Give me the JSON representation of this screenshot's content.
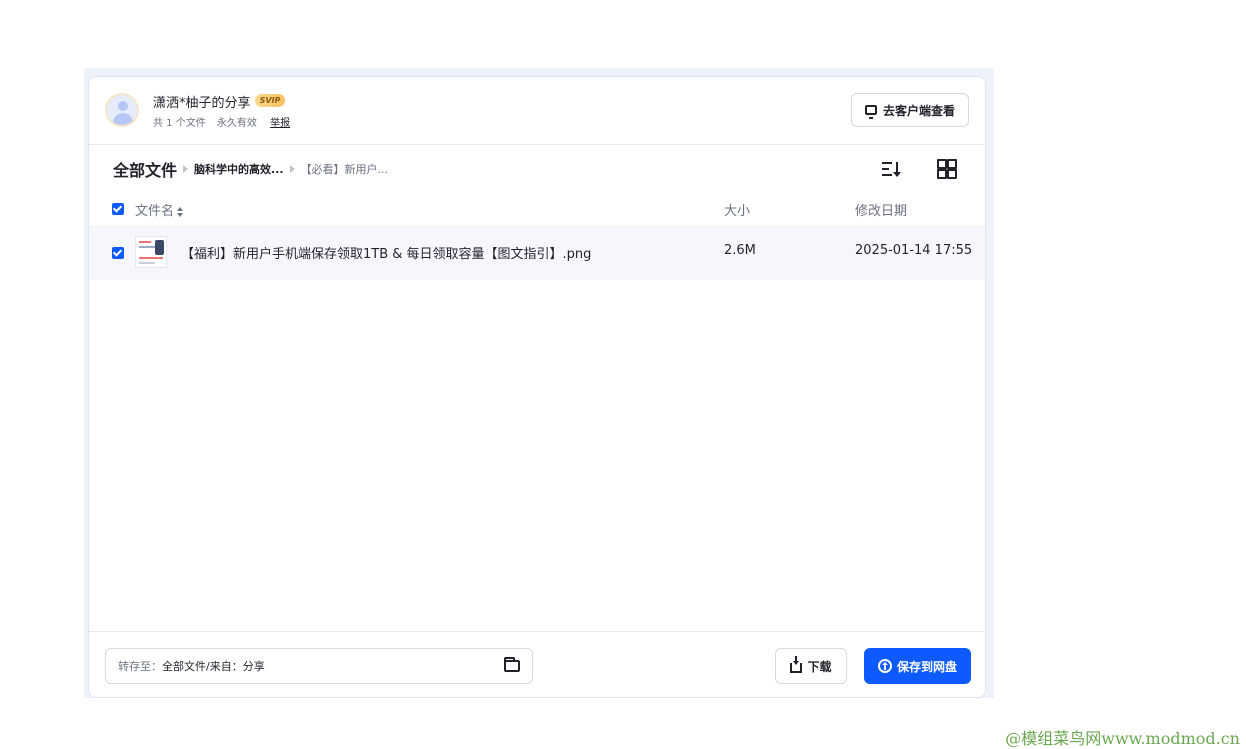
{
  "header": {
    "share_title": "潇洒*柚子的分享",
    "badge": "SVIP",
    "file_count": "共 1 个文件",
    "validity": "永久有效",
    "report": "举报",
    "client_button": "去客户端查看"
  },
  "breadcrumb": {
    "root": "全部文件",
    "folder": "脑科学中的高效...",
    "current": "【必看】新用户..."
  },
  "table": {
    "headers": {
      "name": "文件名",
      "size": "大小",
      "date": "修改日期"
    },
    "rows": [
      {
        "name": "【福利】新用户手机端保存领取1TB & 每日领取容量【图文指引】.png",
        "size": "2.6M",
        "date": "2025-01-14 17:55",
        "checked": true
      }
    ]
  },
  "footer": {
    "save_to_label": "转存至：",
    "save_to_value": "全部文件/来自：分享",
    "download": "下载",
    "save": "保存到网盘"
  },
  "watermark": "@模组菜鸟网www.modmod.cn",
  "colors": {
    "primary": "#0d5bff",
    "row_bg": "#f5f7fd",
    "badge": "#f5c15d"
  }
}
